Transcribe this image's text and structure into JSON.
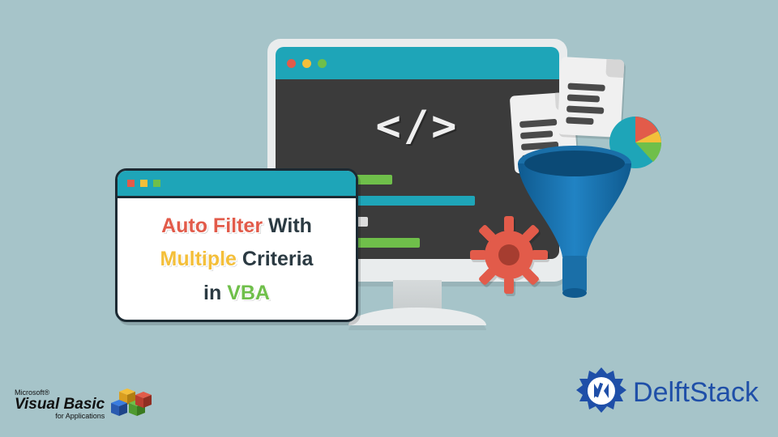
{
  "title_card": {
    "line1_part1": "Auto Filter",
    "line1_part2": " With",
    "line2_part1": "Multiple",
    "line2_part2": " Criteria",
    "line3_part1": "in ",
    "line3_part2": "VBA"
  },
  "code_symbol": "</>",
  "vb_logo": {
    "ms": "Microsoft®",
    "main": "Visual Basic",
    "sub": "for Applications"
  },
  "ds_logo": {
    "text": "DelftStack"
  },
  "colors": {
    "bg": "#a6c4c9",
    "teal": "#1ea5b8",
    "red": "#e25b4a",
    "yellow": "#f4bf3a",
    "green": "#6fbf4a",
    "dark": "#3b3b3b"
  }
}
